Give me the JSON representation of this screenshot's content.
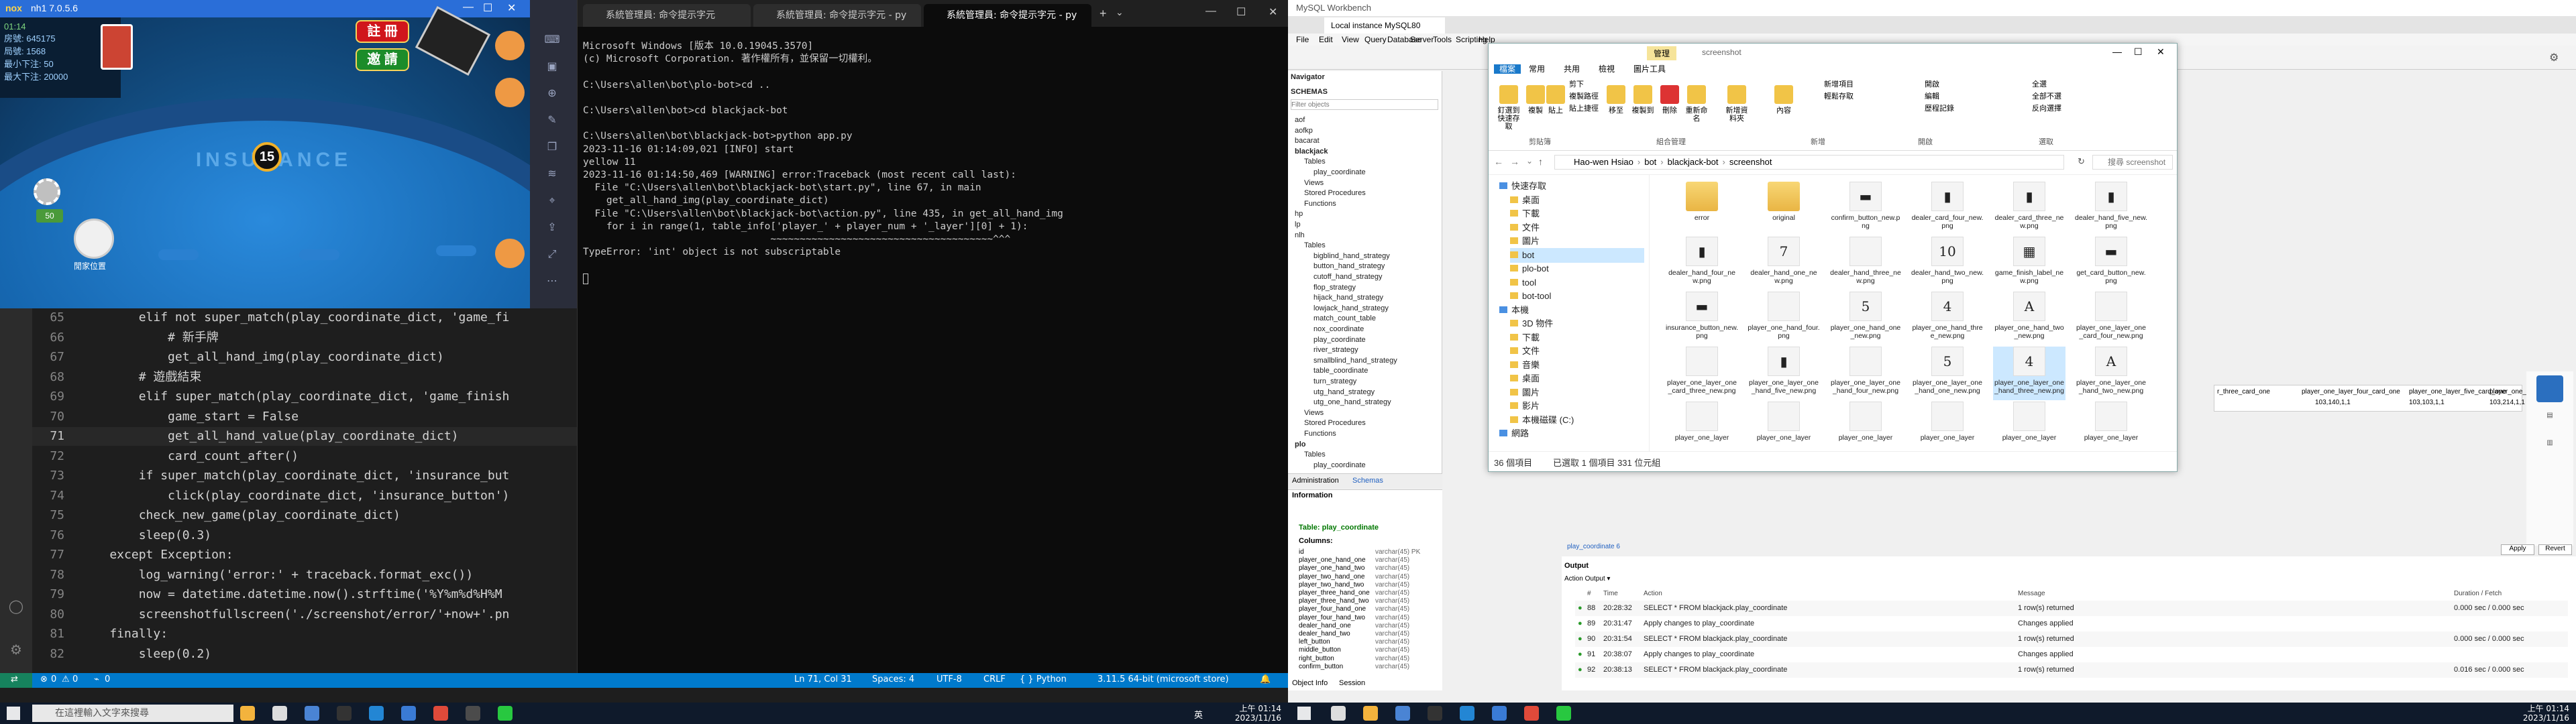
{
  "emulator": {
    "title": "nh1 7.0.5.6",
    "logo": "nox",
    "stats": [
      "房號: 645175",
      "局號: 1568",
      "最小下注: 50",
      "最大下注: 20000"
    ],
    "time": "01:14",
    "timer": "15",
    "register_btn": "註 冊",
    "login_btn": "邀 請",
    "insurance_text": "INSURANCE",
    "chip_value": "50",
    "player_area": "閒家位置"
  },
  "vscode": {
    "code_lines": [
      {
        "n": "65",
        "text": "        elif not super_match(play_coordinate_dict, 'game_fi"
      },
      {
        "n": "66",
        "text": "            # 新手牌"
      },
      {
        "n": "67",
        "text": "            get_all_hand_img(play_coordinate_dict)"
      },
      {
        "n": "68",
        "text": "        # 遊戲結束"
      },
      {
        "n": "69",
        "text": "        elif super_match(play_coordinate_dict, 'game_finish"
      },
      {
        "n": "70",
        "text": "            game_start = False"
      },
      {
        "n": "71",
        "text": "            get_all_hand_value(play_coordinate_dict)"
      },
      {
        "n": "72",
        "text": "            card_count_after()"
      },
      {
        "n": "73",
        "text": "        if super_match(play_coordinate_dict, 'insurance_but"
      },
      {
        "n": "74",
        "text": "            click(play_coordinate_dict, 'insurance_button')"
      },
      {
        "n": "75",
        "text": "        check_new_game(play_coordinate_dict)"
      },
      {
        "n": "76",
        "text": "        sleep(0.3)"
      },
      {
        "n": "77",
        "text": "    except Exception:"
      },
      {
        "n": "78",
        "text": "        log_warning('error:' + traceback.format_exc())"
      },
      {
        "n": "79",
        "text": "        now = datetime.datetime.now().strftime('%Y%m%d%H%M"
      },
      {
        "n": "80",
        "text": "        screenshotfullscreen('./screenshot/error/'+now+'.pn"
      },
      {
        "n": "81",
        "text": "    finally:"
      },
      {
        "n": "82",
        "text": "        sleep(0.2)"
      }
    ],
    "status": {
      "errors": "0",
      "warnings": "0",
      "ports": "0",
      "position": "Ln 71, Col 31",
      "spaces": "Spaces: 4",
      "encoding": "UTF-8",
      "eol": "CRLF",
      "language": "Python",
      "interpreter": "3.11.5 64-bit (microsoft store)"
    }
  },
  "terminal": {
    "tabs": [
      "系統管理員: 命令提示字元",
      "系統管理員: 命令提示字元 - py",
      "系統管理員: 命令提示字元 - py"
    ],
    "lines": [
      "Microsoft Windows [版本 10.0.19045.3570]",
      "(c) Microsoft Corporation. 著作權所有，並保留一切權利。",
      "",
      "C:\\Users\\allen\\bot\\plo-bot>cd ..",
      "",
      "C:\\Users\\allen\\bot>cd blackjack-bot",
      "",
      "C:\\Users\\allen\\bot\\blackjack-bot>python app.py",
      "2023-11-16 01:14:09,021 [INFO] start",
      "yellow 11",
      "2023-11-16 01:14:50,469 [WARNING] error:Traceback (most recent call last):",
      "  File \"C:\\Users\\allen\\bot\\blackjack-bot\\start.py\", line 67, in main",
      "    get_all_hand_img(play_coordinate_dict)",
      "  File \"C:\\Users\\allen\\bot\\blackjack-bot\\action.py\", line 435, in get_all_hand_img",
      "    for i in range(1, table_info['player_' + player_num + '_layer'][0] + 1):",
      "                                ~~~~~~~~~~~~~~~~~~~~~~~~~~~~~~~~~~~~~~^^^",
      "TypeError: 'int' object is not subscriptable"
    ]
  },
  "workbench": {
    "title": "MySQL Workbench",
    "tab": "Local instance MySQL80",
    "menu": [
      "File",
      "Edit",
      "View",
      "Query",
      "Database",
      "Server",
      "Tools",
      "Scripting",
      "Help"
    ],
    "navigator": "Navigator",
    "schemas_label": "SCHEMAS",
    "filter_placeholder": "Filter objects",
    "tree": [
      "aof",
      "aofkp",
      "bacarat",
      "blackjack",
      "Tables",
      "play_coordinate",
      "Views",
      "Stored Procedures",
      "Functions",
      "hp",
      "lp",
      "nlh",
      "Tables",
      "bigblind_hand_strategy",
      "button_hand_strategy",
      "cutoff_hand_strategy",
      "flop_strategy",
      "hijack_hand_strategy",
      "lowjack_hand_strategy",
      "match_count_table",
      "nox_coordinate",
      "play_coordinate",
      "river_strategy",
      "smallblind_hand_strategy",
      "table_coordinate",
      "turn_strategy",
      "utg_hand_strategy",
      "utg_one_hand_strategy",
      "Views",
      "Stored Procedures",
      "Functions",
      "plo",
      "Tables",
      "play_coordinate"
    ],
    "bottom_tabs": [
      "Administration",
      "Schemas"
    ],
    "info_label": "Information",
    "info_table": "Table: play_coordinate",
    "columns_label": "Columns:",
    "columns": [
      [
        "id",
        "varchar(45) PK"
      ],
      [
        "player_one_hand_one",
        "varchar(45)"
      ],
      [
        "player_one_hand_two",
        "varchar(45)"
      ],
      [
        "player_two_hand_one",
        "varchar(45)"
      ],
      [
        "player_two_hand_two",
        "varchar(45)"
      ],
      [
        "player_three_hand_one",
        "varchar(45)"
      ],
      [
        "player_three_hand_two",
        "varchar(45)"
      ],
      [
        "player_four_hand_one",
        "varchar(45)"
      ],
      [
        "player_four_hand_two",
        "varchar(45)"
      ],
      [
        "dealer_hand_one",
        "varchar(45)"
      ],
      [
        "dealer_hand_two",
        "varchar(45)"
      ],
      [
        "left_button",
        "varchar(45)"
      ],
      [
        "middle_button",
        "varchar(45)"
      ],
      [
        "right_button",
        "varchar(45)"
      ],
      [
        "confirm_button",
        "varchar(45)"
      ]
    ],
    "info_tabs": [
      "Object Info",
      "Session"
    ],
    "result_tab": "play_coordinate 6",
    "output_label": "Output",
    "action_output": "Action Output",
    "out_headers": [
      "#",
      "Time",
      "Action",
      "Message",
      "Duration / Fetch"
    ],
    "out_rows": [
      [
        "88",
        "20:28:32",
        "SELECT * FROM blackjack.play_coordinate",
        "1 row(s) returned",
        "0.000 sec / 0.000 sec"
      ],
      [
        "89",
        "20:31:47",
        "Apply changes to play_coordinate",
        "Changes applied",
        ""
      ],
      [
        "90",
        "20:31:54",
        "SELECT * FROM blackjack.play_coordinate",
        "1 row(s) returned",
        "0.000 sec / 0.000 sec"
      ],
      [
        "91",
        "20:38:07",
        "Apply changes to play_coordinate",
        "Changes applied",
        ""
      ],
      [
        "92",
        "20:38:13",
        "SELECT * FROM blackjack.play_coordinate",
        "1 row(s) returned",
        "0.016 sec / 0.000 sec"
      ]
    ],
    "grid_headers": [
      "r_three_card_one",
      "player_one_layer_four_card_one",
      "player_one_layer_five_card_one",
      "player_one_"
    ],
    "grid_values": [
      "103,140,1,1",
      "103,103,1,1",
      "103,214,1,1"
    ],
    "apply": "Apply",
    "revert": "Revert"
  },
  "explorer": {
    "path": [
      "Hao-wen Hsiao",
      "bot",
      "blackjack-bot",
      "screenshot"
    ],
    "search_placeholder": "搜尋 screenshot",
    "ribbon_tabs": [
      "檔案",
      "常用",
      "共用",
      "檢視",
      "圖片工具"
    ],
    "manage_tab": "管理",
    "window_title": "screenshot",
    "ribbon_groups": [
      "剪貼簿",
      "組合管理",
      "新增",
      "開啟",
      "選取"
    ],
    "ribbon_btns": [
      "釘選到快速存取",
      "複製",
      "貼上",
      "移至",
      "複製到",
      "刪除",
      "重新命名",
      "新增資料夾",
      "內容",
      "全選",
      "全部不選",
      "反向選擇"
    ],
    "ribbon_small": [
      "剪下",
      "複製路徑",
      "貼上捷徑",
      "新增項目",
      "輕鬆存取",
      "開啟",
      "編輯",
      "歷程記錄"
    ],
    "nav": [
      "快速存取",
      "桌面",
      "下載",
      "文件",
      "圖片",
      "bot",
      "plo-bot",
      "tool",
      "bot-tool",
      "本機",
      "3D 物件",
      "下載",
      "文件",
      "音樂",
      "桌面",
      "圖片",
      "影片",
      "本機磁碟 (C:)",
      "網路"
    ],
    "files": [
      {
        "name": "error",
        "type": "folder"
      },
      {
        "name": "original",
        "type": "folder"
      },
      {
        "name": "confirm_button_new.png",
        "glyph": "▬"
      },
      {
        "name": "dealer_card_four_new.png",
        "glyph": "▮"
      },
      {
        "name": "dealer_card_three_new.png",
        "glyph": "▮"
      },
      {
        "name": "dealer_hand_five_new.png",
        "glyph": "▮"
      },
      {
        "name": "dealer_hand_four_new.png",
        "glyph": "▮"
      },
      {
        "name": "dealer_hand_one_new.png",
        "glyph": "7"
      },
      {
        "name": "dealer_hand_three_new.png",
        "glyph": ""
      },
      {
        "name": "dealer_hand_two_new.png",
        "glyph": "10"
      },
      {
        "name": "game_finish_label_new.png",
        "glyph": "▦"
      },
      {
        "name": "get_card_button_new.png",
        "glyph": "▬"
      },
      {
        "name": "insurance_button_new.png",
        "glyph": "▬"
      },
      {
        "name": "player_one_hand_four.png",
        "glyph": ""
      },
      {
        "name": "player_one_hand_one_new.png",
        "glyph": "5"
      },
      {
        "name": "player_one_hand_three_new.png",
        "glyph": "4"
      },
      {
        "name": "player_one_hand_two_new.png",
        "glyph": "A"
      },
      {
        "name": "player_one_layer_one_card_four_new.png",
        "glyph": ""
      },
      {
        "name": "player_one_layer_one_card_three_new.png",
        "glyph": ""
      },
      {
        "name": "player_one_layer_one_hand_five_new.png",
        "glyph": "▮"
      },
      {
        "name": "player_one_layer_one_hand_four_new.png",
        "glyph": ""
      },
      {
        "name": "player_one_layer_one_hand_one_new.png",
        "glyph": "5"
      },
      {
        "name": "player_one_layer_one_hand_three_new.png",
        "glyph": "4"
      },
      {
        "name": "player_one_layer_one_hand_two_new.png",
        "glyph": "A"
      },
      {
        "name": "player_one_layer",
        "glyph": ""
      },
      {
        "name": "player_one_layer",
        "glyph": ""
      },
      {
        "name": "player_one_layer",
        "glyph": ""
      },
      {
        "name": "player_one_layer",
        "glyph": ""
      },
      {
        "name": "player_one_layer",
        "glyph": ""
      },
      {
        "name": "player_one_layer",
        "glyph": ""
      }
    ],
    "status_items": "36 個項目",
    "status_selected": "已選取 1 個項目  331 位元組"
  },
  "taskbar": {
    "search_placeholder": "在這裡輸入文字來搜尋",
    "time": "上午 01:14",
    "date": "2023/11/16",
    "ime": "英",
    "right_time": "上午 01:14",
    "right_date": "2023/11/16"
  }
}
